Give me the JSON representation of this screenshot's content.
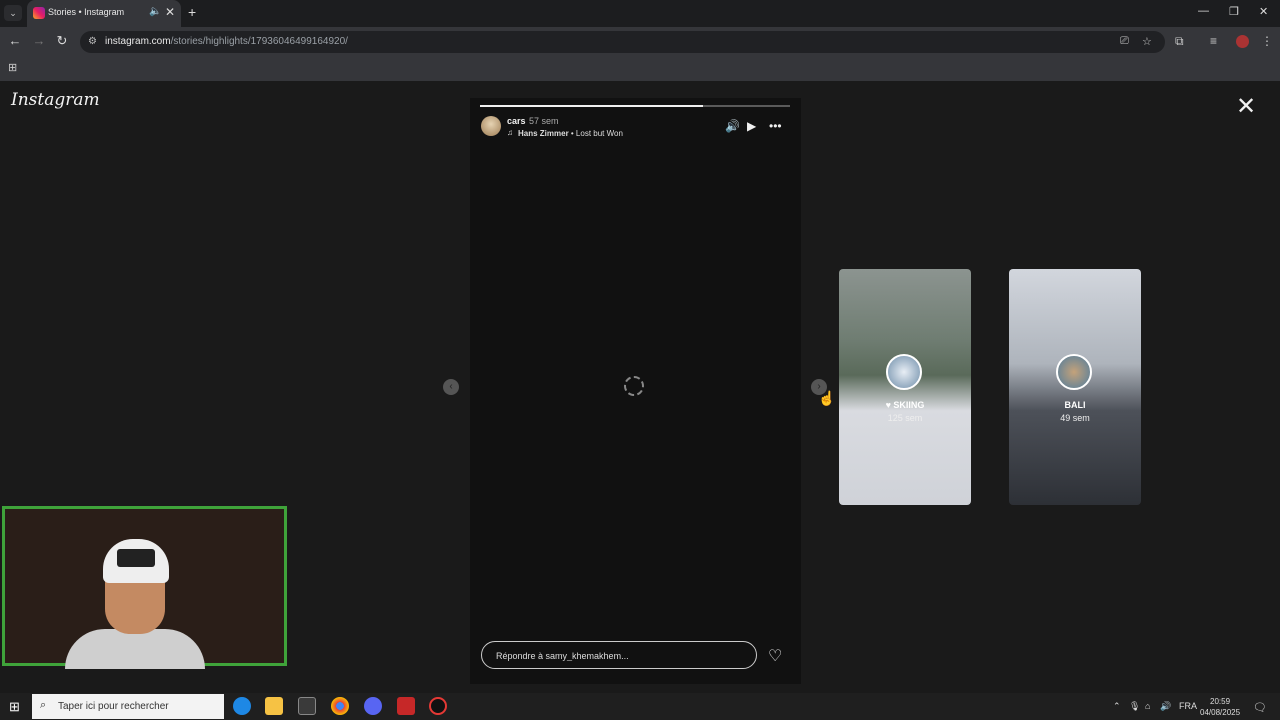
{
  "browser": {
    "tab_title": "Stories • Instagram",
    "tab_audio_icon": "speaker-icon",
    "url_host": "instagram.com",
    "url_path": "/stories/highlights/17936046499164920/"
  },
  "instagram": {
    "logo": "Instagram",
    "story": {
      "username": "cars",
      "time": "57 sem",
      "music_artist": "Hans Zimmer",
      "music_track": " • Lost but Won",
      "progress": 0.72
    },
    "reply_placeholder": "Répondre à samy_khemakhem...",
    "highlights": [
      {
        "name": "SKIING",
        "time": "125 sem",
        "prefix": "♥ "
      },
      {
        "name": "BALI",
        "time": "49 sem",
        "prefix": ""
      }
    ]
  },
  "taskbar": {
    "search_placeholder": "Taper ici pour rechercher",
    "language": "FRA",
    "time": "20:59",
    "date": "04/08/2025"
  },
  "colors": {
    "webcam_border": "#3fa33a",
    "page_bg": "#1a1a1a"
  }
}
